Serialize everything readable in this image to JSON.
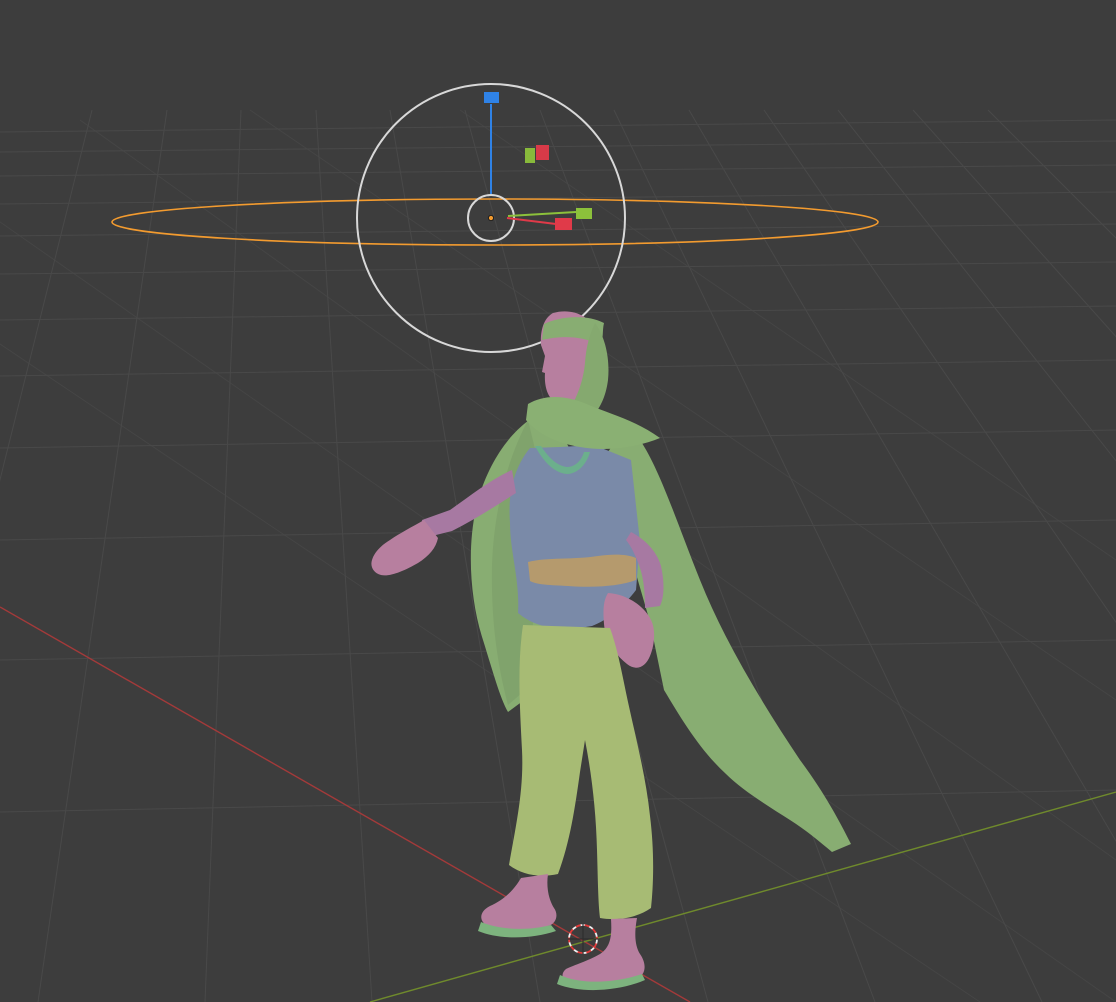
{
  "viewport": {
    "background": "#3d3d3d",
    "grid_color": "#4a4a4a",
    "axis_colors": {
      "x_axis": "#a33a3a",
      "y_axis": "#6f8a2c"
    }
  },
  "light": {
    "selected_outline_color": "#f39b2f",
    "gizmo_ring_color": "#d8d8d8"
  },
  "transform_gizmo": {
    "colors": {
      "x_handle": "#e03a49",
      "y_handle": "#8cc13b",
      "z_handle": "#2f82e6",
      "plane_xz": "#e03a49",
      "plane_yz": "#8cc13b"
    }
  },
  "character": {
    "colors": {
      "skin": "#b77f9f",
      "cloak": "#88ad72",
      "shirt": "#7a8aa8",
      "trousers": "#a7bb74",
      "belt": "#b59a6d",
      "sandals": "#7db37e"
    }
  },
  "cursor_3d": {
    "colors": {
      "ring": "#f0f0f0",
      "dash": "#e43838"
    }
  }
}
